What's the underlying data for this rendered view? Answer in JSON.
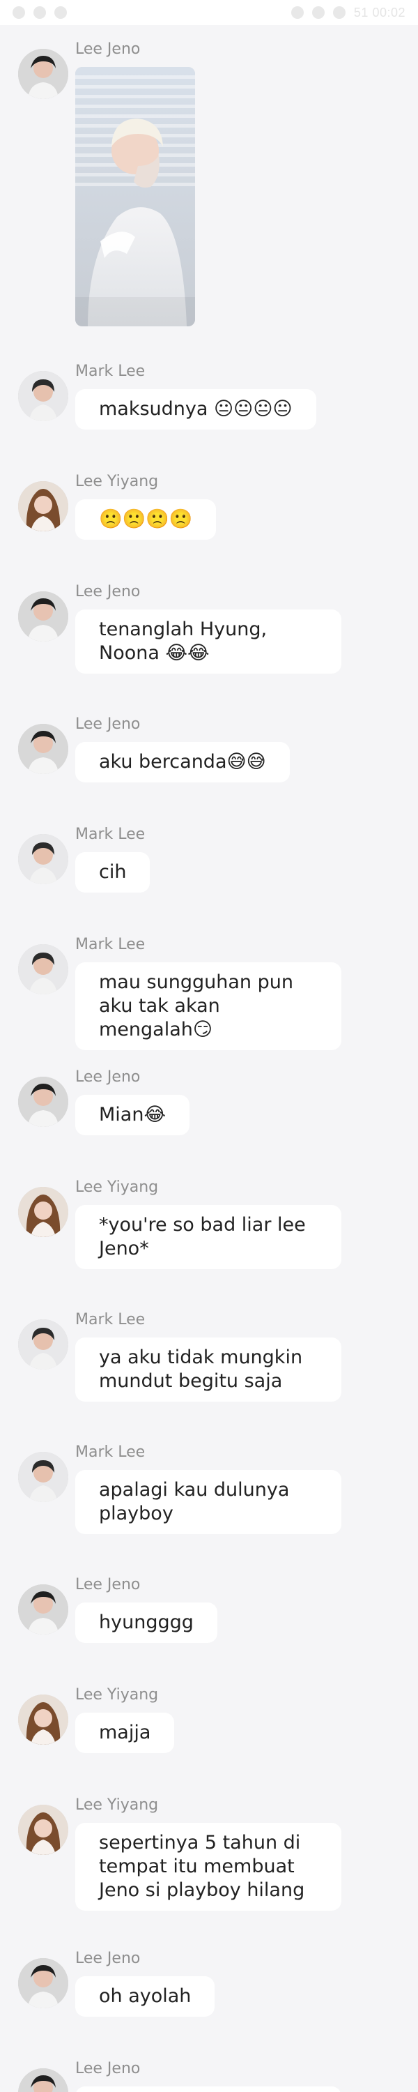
{
  "status_bar": {
    "time": "51 00:02"
  },
  "messages": [
    {
      "sender": "Lee Jeno",
      "type": "image"
    },
    {
      "sender": "Mark Lee",
      "type": "text",
      "text": "maksudnya 😐😐😐😐"
    },
    {
      "sender": "Lee Yiyang",
      "type": "text",
      "text": "🙁🙁🙁🙁"
    },
    {
      "sender": "Lee Jeno",
      "type": "text",
      "text": "tenanglah Hyung, Noona 😂😂"
    },
    {
      "sender": "Lee Jeno",
      "type": "text",
      "text": "aku bercanda😅😅"
    },
    {
      "sender": "Mark Lee",
      "type": "text",
      "text": "cih"
    },
    {
      "sender": "Mark Lee",
      "type": "text",
      "text": "mau sungguhan pun aku tak akan mengalah😏"
    },
    {
      "sender": "Lee Jeno",
      "type": "text",
      "text": "Mian😂"
    },
    {
      "sender": "Lee Yiyang",
      "type": "text",
      "text": "*you're so bad liar lee Jeno*"
    },
    {
      "sender": "Mark Lee",
      "type": "text",
      "text": "ya aku tidak mungkin mundut begitu saja"
    },
    {
      "sender": "Mark Lee",
      "type": "text",
      "text": "apalagi kau dulunya playboy"
    },
    {
      "sender": "Lee Jeno",
      "type": "text",
      "text": "hyungggg"
    },
    {
      "sender": "Lee Yiyang",
      "type": "text",
      "text": "majja"
    },
    {
      "sender": "Lee Yiyang",
      "type": "text",
      "text": "sepertinya 5 tahun di tempat itu membuat Jeno si playboy hilang"
    },
    {
      "sender": "Lee Jeno",
      "type": "text",
      "text": "oh ayolah"
    },
    {
      "sender": "Lee Jeno",
      "type": "text",
      "text": ""
    }
  ]
}
